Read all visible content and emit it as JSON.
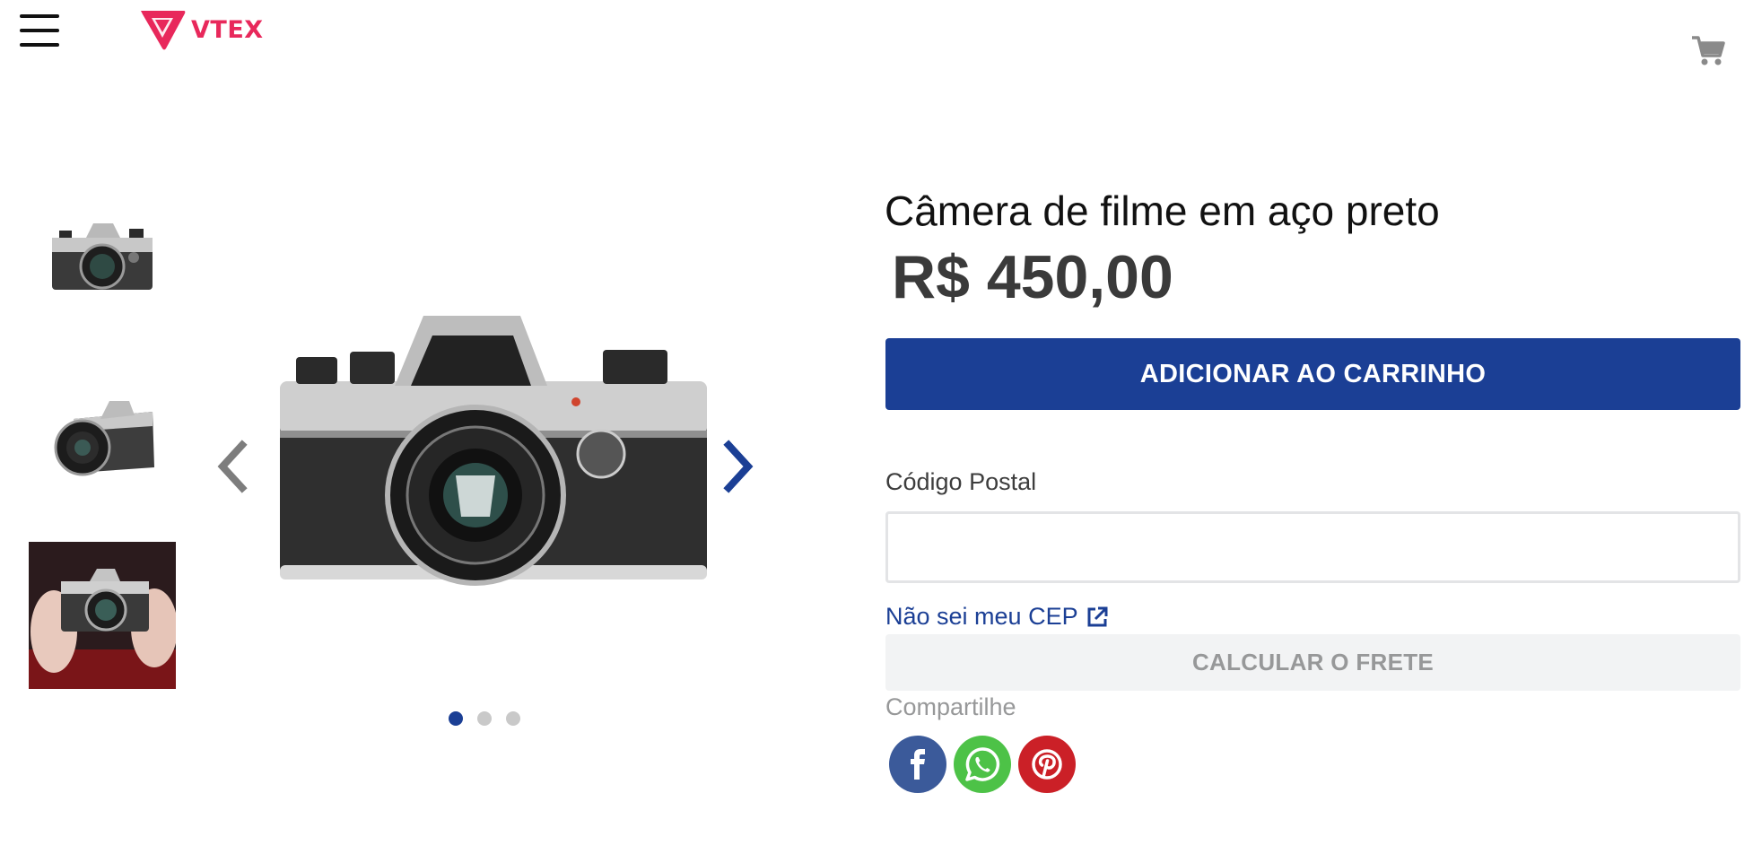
{
  "header": {
    "logo_text": "VTEX",
    "menu_icon": "hamburger-menu-icon",
    "cart_icon": "cart-icon",
    "brand_color": "#e8285b"
  },
  "gallery": {
    "thumbnails": [
      {
        "icon": "camera-front-thumbnail"
      },
      {
        "icon": "camera-angle-thumbnail"
      },
      {
        "icon": "camera-in-hands-thumbnail"
      }
    ],
    "prev_icon": "chevron-left-icon",
    "next_icon": "chevron-right-icon",
    "active_slide": 1,
    "slide_count": 3
  },
  "product": {
    "name": "Câmera de filme em aço preto",
    "price": "R$ 450,00",
    "add_to_cart_label": "ADICIONAR AO CARRINHO",
    "accent_color": "#1b3f95"
  },
  "shipping": {
    "postal_label": "Código Postal",
    "postal_value": "",
    "postal_placeholder": "",
    "cep_link": "Não sei meu CEP",
    "calc_label": "CALCULAR O FRETE"
  },
  "share": {
    "label": "Compartilhe",
    "networks": [
      {
        "name": "facebook-icon",
        "color": "#3b5a9a"
      },
      {
        "name": "whatsapp-icon",
        "color": "#4dc247"
      },
      {
        "name": "pinterest-icon",
        "color": "#cb2027"
      }
    ]
  }
}
